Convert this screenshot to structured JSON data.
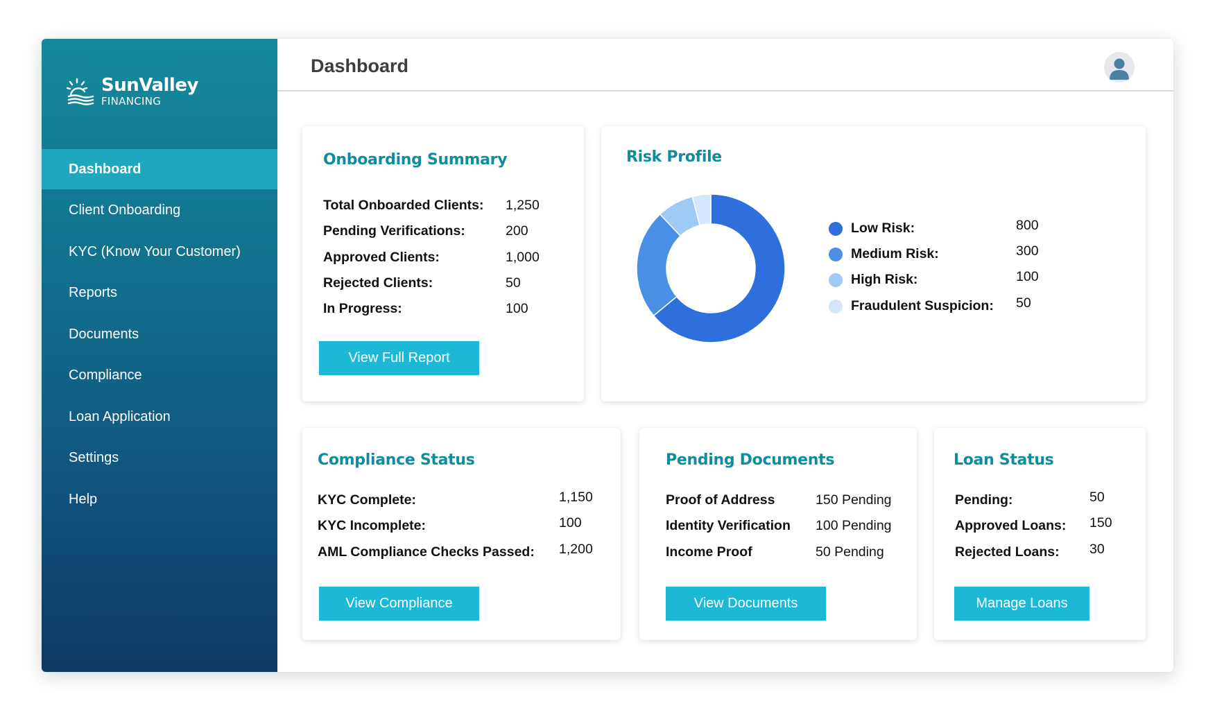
{
  "brand": {
    "name": "SunValley",
    "tagline": "FINANCING"
  },
  "sidebar": {
    "items": [
      {
        "label": "Dashboard",
        "active": true
      },
      {
        "label": "Client Onboarding"
      },
      {
        "label": "KYC (Know Your Customer)"
      },
      {
        "label": "Reports"
      },
      {
        "label": "Documents"
      },
      {
        "label": "Compliance"
      },
      {
        "label": "Loan Application"
      },
      {
        "label": "Settings"
      },
      {
        "label": "Help"
      }
    ]
  },
  "header": {
    "title": "Dashboard",
    "avatar_icon": "user-icon"
  },
  "onboarding": {
    "title": "Onboarding Summary",
    "rows": [
      {
        "label": "Total Onboarded Clients:",
        "value": "1,250"
      },
      {
        "label": "Pending Verifications:",
        "value": "200"
      },
      {
        "label": "Approved Clients:",
        "value": "1,000"
      },
      {
        "label": "Rejected Clients:",
        "value": "50"
      },
      {
        "label": "In Progress:",
        "value": "100"
      }
    ],
    "button": "View Full Report"
  },
  "risk": {
    "title": "Risk Profile",
    "legend": [
      {
        "label": "Low Risk:",
        "value": "800",
        "color": "#2f6fdc"
      },
      {
        "label": "Medium Risk:",
        "value": "300",
        "color": "#4a8fe6"
      },
      {
        "label": "High Risk:",
        "value": "100",
        "color": "#9fcaf5"
      },
      {
        "label": "Fraudulent Suspicion:",
        "value": "50",
        "color": "#d3e6fb"
      }
    ]
  },
  "chart_data": {
    "type": "pie",
    "donut": true,
    "categories": [
      "Low Risk",
      "Medium Risk",
      "High Risk",
      "Fraudulent Suspicion"
    ],
    "values": [
      800,
      300,
      100,
      50
    ],
    "colors": [
      "#2f6fdc",
      "#4a8fe6",
      "#9fcaf5",
      "#d3e6fb"
    ]
  },
  "compliance": {
    "title": "Compliance Status",
    "rows": [
      {
        "label": "KYC Complete:",
        "value": "1,150"
      },
      {
        "label": "KYC Incomplete:",
        "value": "100"
      },
      {
        "label": "AML Compliance Checks Passed:",
        "value": "1,200"
      }
    ],
    "button": "View Compliance"
  },
  "documents": {
    "title": "Pending Documents",
    "rows": [
      {
        "label": "Proof of Address",
        "value": "150 Pending"
      },
      {
        "label": "Identity Verification",
        "value": "100 Pending"
      },
      {
        "label": "Income Proof",
        "value": "50 Pending"
      }
    ],
    "button": "View Documents"
  },
  "loans": {
    "title": "Loan Status",
    "rows": [
      {
        "label": "Pending:",
        "value": "50"
      },
      {
        "label": "Approved Loans:",
        "value": "150"
      },
      {
        "label": "Rejected Loans:",
        "value": "30"
      }
    ],
    "button": "Manage Loans"
  }
}
